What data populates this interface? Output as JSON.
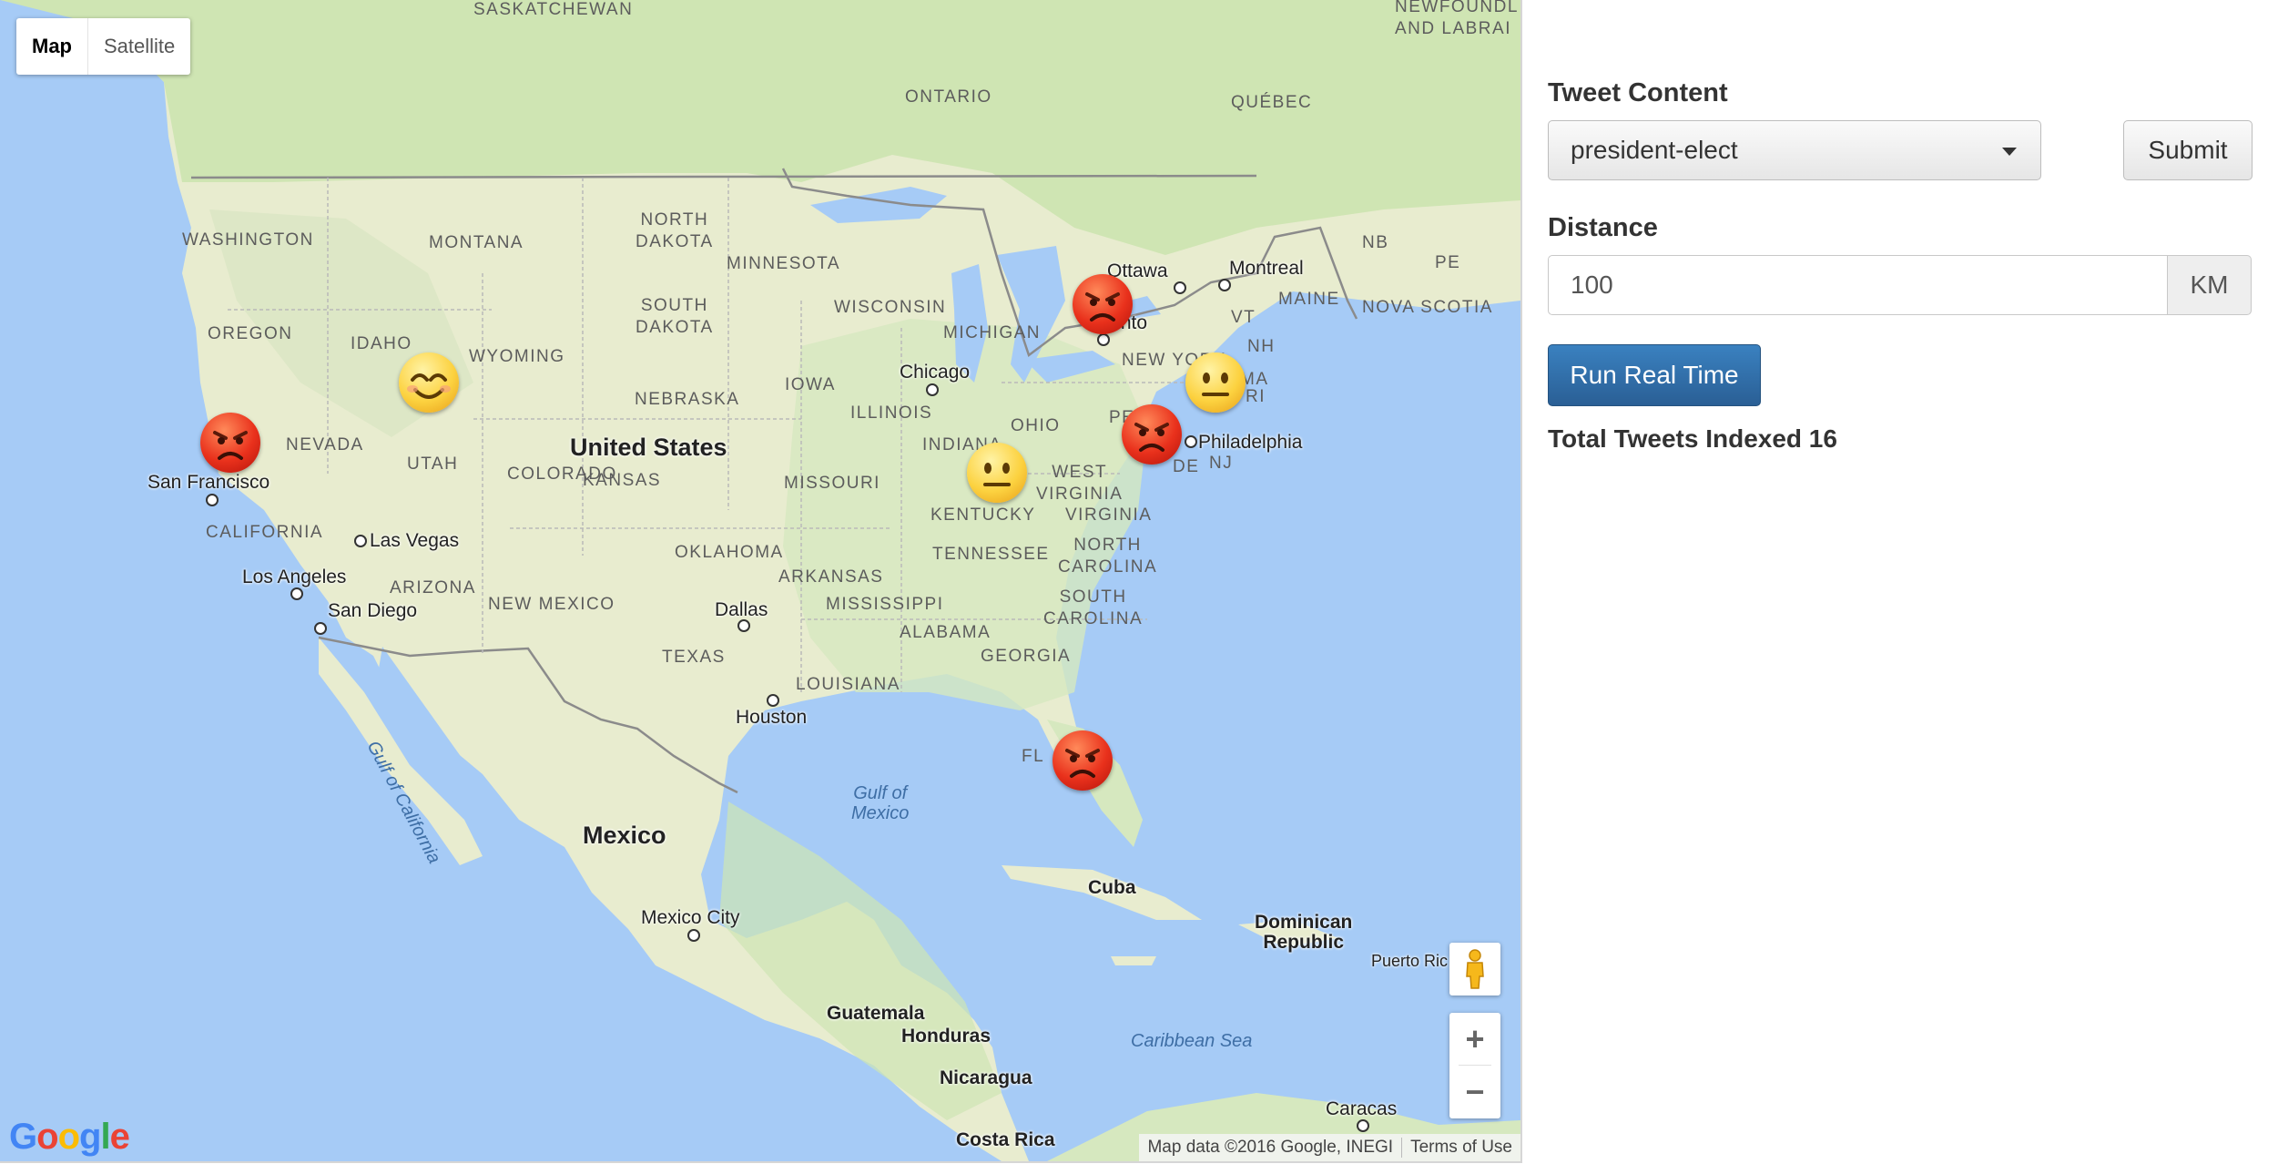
{
  "map": {
    "type_control": {
      "map": "Map",
      "satellite": "Satellite",
      "selected": "Map"
    },
    "countries": {
      "united_states": "United States",
      "mexico": "Mexico",
      "cuba": "Cuba",
      "dominican_republic": "Dominican\nRepublic",
      "guatemala": "Guatemala",
      "honduras": "Honduras",
      "nicaragua": "Nicaragua",
      "costa_rica": "Costa Rica"
    },
    "regions": {
      "washington": "WASHINGTON",
      "oregon": "OREGON",
      "idaho": "IDAHO",
      "montana": "MONTANA",
      "wyoming": "WYOMING",
      "nevada": "NEVADA",
      "utah": "UTAH",
      "colorado": "COLORADO",
      "california": "CALIFORNIA",
      "arizona": "ARIZONA",
      "new_mexico": "NEW MEXICO",
      "north_dakota": "NORTH\nDAKOTA",
      "south_dakota": "SOUTH\nDAKOTA",
      "nebraska": "NEBRASKA",
      "kansas": "KANSAS",
      "oklahoma": "OKLAHOMA",
      "texas": "TEXAS",
      "minnesota": "MINNESOTA",
      "iowa": "IOWA",
      "missouri": "MISSOURI",
      "arkansas": "ARKANSAS",
      "louisiana": "LOUISIANA",
      "wisconsin": "WISCONSIN",
      "illinois": "ILLINOIS",
      "michigan": "MICHIGAN",
      "indiana": "INDIANA",
      "ohio": "OHIO",
      "kentucky": "KENTUCKY",
      "tennessee": "TENNESSEE",
      "mississippi": "MISSISSIPPI",
      "alabama": "ALABAMA",
      "georgia": "GEORGIA",
      "south_carolina": "SOUTH\nCAROLINA",
      "north_carolina": "NORTH\nCAROLINA",
      "virginia": "VIRGINIA",
      "west_virginia": "WEST\nVIRGINIA",
      "new_york": "NEW YORK",
      "vt": "VT",
      "nh": "NH",
      "maine": "MAINE",
      "nj": "NJ",
      "de": "DE",
      "ma": "MA",
      "ri": "RI",
      "pa": "PE",
      "fl": "FL",
      "ontario": "ONTARIO",
      "quebec": "QUÉBEC",
      "nb": "NB",
      "pe": "PE",
      "nova_scotia": "NOVA SCOTIA",
      "newfoundland": "NEWFOUNDL\nAND LABRAI",
      "saskatchewan": "SASKATCHEWAN"
    },
    "cities": {
      "san_francisco": "San Francisco",
      "las_vegas": "Las Vegas",
      "los_angeles": "Los Angeles",
      "san_diego": "San Diego",
      "dallas": "Dallas",
      "houston": "Houston",
      "chicago": "Chicago",
      "toronto": "Toronto",
      "ottawa": "Ottawa",
      "montreal": "Montreal",
      "philadelphia": "Philadelphia",
      "mexico_city": "Mexico City",
      "puerto_rico": "Puerto Ric",
      "caracas": "Caracas"
    },
    "water": {
      "gulf_of_mexico": "Gulf of\nMexico",
      "gulf_of_california": "Gulf of California",
      "caribbean_sea": "Caribbean Sea"
    },
    "markers": [
      {
        "sentiment": "angry",
        "place": "San Francisco"
      },
      {
        "sentiment": "smile",
        "place": "Idaho"
      },
      {
        "sentiment": "angry",
        "place": "Toronto"
      },
      {
        "sentiment": "neutral",
        "place": "Massachusetts"
      },
      {
        "sentiment": "angry",
        "place": "Pennsylvania"
      },
      {
        "sentiment": "neutral",
        "place": "Indiana"
      },
      {
        "sentiment": "angry",
        "place": "Florida"
      }
    ],
    "controls": {
      "pegman_icon": "pegman-icon",
      "zoom_in": "+",
      "zoom_out": "−"
    },
    "attribution": {
      "data": "Map data ©2016 Google, INEGI",
      "terms": "Terms of Use"
    },
    "logo": "Google"
  },
  "panel": {
    "tweet_content_label": "Tweet Content",
    "tweet_content_value": "president-elect",
    "submit_label": "Submit",
    "distance_label": "Distance",
    "distance_value": "100",
    "distance_unit": "KM",
    "run_button": "Run Real Time",
    "total_label": "Total Tweets Indexed 16"
  },
  "colors": {
    "ocean": "#a6cbf6",
    "land": "#e8eccf",
    "accent": "#2f6ea8",
    "angry": "#e53d22",
    "neutral": "#fcd240"
  }
}
